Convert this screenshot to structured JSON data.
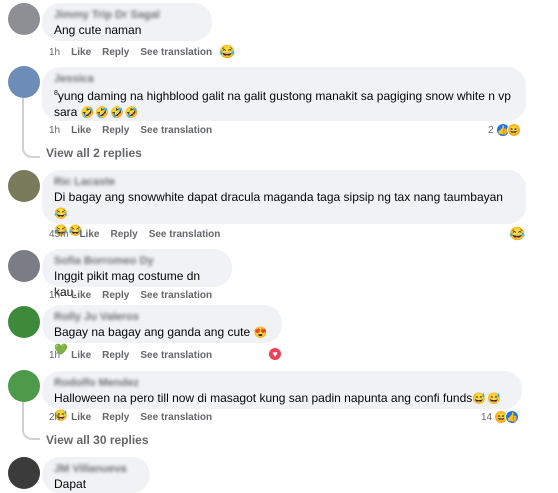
{
  "comments": [
    {
      "author": "Jimmy Trip Dr Sagal",
      "text": "Ang cute naman",
      "time": "1h",
      "like_label": "Like",
      "reply_label": "Reply",
      "translate_label": "See translation",
      "reaction_emoji": "😂"
    },
    {
      "author": "Jessica",
      "text": "yung daming na highblood galit na galit gustong manakit sa pagiging snow white n vp sara",
      "text_prefix": "8",
      "text_emoji": "🤣🤣🤣🤣",
      "time": "1h",
      "like_label": "Like",
      "reply_label": "Reply",
      "translate_label": "See translation",
      "reaction_count": "2"
    },
    {
      "author": "Ric Lacaste",
      "text": "Di bagay ang snowwhite dapat dracula maganda taga sipsip ng tax nang taumbayan",
      "text_emoji_1": "😂",
      "text_emoji_2": "😂😂",
      "time": "45m",
      "like_label": "Like",
      "reply_label": "Reply",
      "translate_label": "See translation",
      "reaction_emoji": "😂"
    },
    {
      "author": "Sofia Borromeo Dy",
      "text": "Inggit pikit mag costume dn kau.",
      "time": "1h",
      "like_label": "Like",
      "reply_label": "Reply",
      "translate_label": "See translation"
    },
    {
      "author": "Rolly Ju Valeros",
      "text": "Bagay na bagay ang ganda ang cute",
      "text_emoji": "😍💚",
      "time": "1h",
      "like_label": "Like",
      "reply_label": "Reply",
      "translate_label": "See translation"
    },
    {
      "author": "Rodolfo Mendez",
      "text": "Halloween na pero till now di masagot kung san padin napunta ang confi funds",
      "text_emoji": "😅😅😅",
      "time": "2h",
      "like_label": "Like",
      "reply_label": "Reply",
      "translate_label": "See translation",
      "reaction_count": "14"
    },
    {
      "author": "JM Villanueva",
      "text": "Dapat malificient"
    }
  ],
  "view_replies": [
    "View all 2 replies",
    "View all 30 replies"
  ],
  "icons": {
    "like": "like-icon",
    "love": "love-icon",
    "haha": "haha-icon"
  },
  "colors": {
    "bubble": "#f0f2f5",
    "meta": "#65676b",
    "like": "#1877f2",
    "love": "#f33e58"
  }
}
